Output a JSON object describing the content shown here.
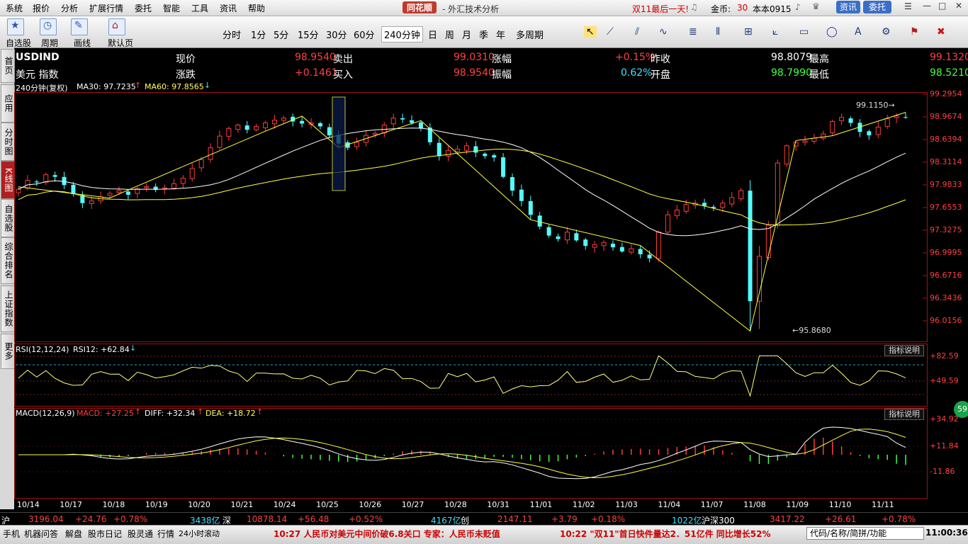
{
  "menu": [
    "系统",
    "报价",
    "分析",
    "扩展行情",
    "委托",
    "智能",
    "工具",
    "资讯",
    "帮助"
  ],
  "brand": {
    "name": "同花顺",
    "subtitle": "- 外汇技术分析"
  },
  "promo": "双11最后一天!",
  "account": {
    "gold_label": "金币:",
    "gold_value": "30",
    "user": "本本0915"
  },
  "top_buttons": {
    "info": "资讯",
    "trade": "委托"
  },
  "toolbar": {
    "left_buttons": [
      "自选股",
      "周期",
      "画线",
      "默认页"
    ],
    "periods": [
      "分时",
      "1分",
      "5分",
      "15分",
      "30分",
      "60分",
      "240分钟",
      "日",
      "周",
      "月",
      "季",
      "年",
      "多周期"
    ],
    "selected_period": "240分钟"
  },
  "left_tabs": [
    "首页",
    "应用",
    "分时图",
    "K线图",
    "自选股",
    "综合排名",
    "上证指数",
    "更多"
  ],
  "quote": {
    "symbol": "USDIND",
    "name": "美元 指数",
    "labels": {
      "price": "现价",
      "change": "涨跌",
      "sell": "卖出",
      "buy": "买入",
      "pct": "涨幅",
      "amp": "振幅",
      "prev": "昨收",
      "open": "开盘",
      "high": "最高",
      "low": "最低"
    },
    "price": "98.9540",
    "change": "+0.1461",
    "sell": "99.0310",
    "buy": "98.9540",
    "pct": "+0.15%",
    "amp": "0.62%",
    "prev": "98.8079",
    "open": "98.7990",
    "high": "99.1320",
    "low": "98.5210"
  },
  "indicators": {
    "main": {
      "title": "240分钟(复权)",
      "ma30_label": "MA30: 97.7235",
      "ma60_label": "MA60: 97.8565"
    },
    "rsi": {
      "title": "RSI(12,12,24)",
      "value_label": "RSI12: +62.84"
    },
    "macd": {
      "title": "MACD(12,26,9)",
      "macd_label": "MACD: +27.25",
      "diff_label": "DIFF: +32.34",
      "dea_label": "DEA: +18.72"
    },
    "explain": "指标说明"
  },
  "chart_data": {
    "type": "candlestick",
    "price_axis": [
      "99.2954",
      "98.9674",
      "98.6394",
      "98.3114",
      "97.9833",
      "97.6553",
      "97.3275",
      "96.9995",
      "96.6716",
      "96.3436",
      "96.0156"
    ],
    "rsi_axis": [
      "+82.59",
      "+49.59"
    ],
    "macd_axis": [
      "+34.92",
      "+11.84",
      "-11.86"
    ],
    "annotations": {
      "high": "99.1150",
      "low": "95.8680"
    },
    "dates": [
      "10/14",
      "10/17",
      "10/18",
      "10/19",
      "10/20",
      "10/21",
      "10/24",
      "10/25",
      "10/26",
      "10/27",
      "10/28",
      "10/31",
      "11/01",
      "11/02",
      "11/03",
      "11/04",
      "11/07",
      "11/08",
      "11/09",
      "11/10",
      "11/11"
    ],
    "close_series": [
      97.92,
      98.05,
      98.02,
      98.13,
      98.1,
      97.98,
      97.85,
      97.72,
      97.75,
      97.81,
      97.86,
      97.9,
      97.84,
      97.93,
      97.96,
      97.91,
      97.94,
      98.0,
      98.08,
      98.22,
      98.35,
      98.52,
      98.69,
      98.8,
      98.85,
      98.78,
      98.83,
      98.88,
      98.92,
      98.95,
      98.9,
      98.87,
      98.88,
      98.83,
      98.7,
      98.58,
      98.52,
      98.6,
      98.7,
      98.73,
      98.85,
      98.95,
      98.93,
      98.88,
      98.8,
      98.6,
      98.4,
      98.48,
      98.5,
      98.55,
      98.45,
      98.4,
      98.38,
      98.1,
      97.9,
      97.75,
      97.55,
      97.38,
      97.25,
      97.2,
      97.3,
      97.18,
      97.1,
      97.12,
      97.15,
      97.08,
      97.02,
      97.06,
      96.98,
      96.92,
      97.3,
      97.55,
      97.62,
      97.7,
      97.72,
      97.68,
      97.65,
      97.72,
      97.8,
      97.9,
      96.28,
      96.95,
      97.4,
      98.3,
      98.55,
      98.6,
      98.62,
      98.66,
      98.72,
      98.9,
      98.96,
      98.88,
      98.75,
      98.7,
      98.82,
      98.94,
      98.98,
      98.96
    ]
  },
  "ticker": [
    {
      "label": "沪",
      "color": "#ffffff"
    },
    {
      "label": "3196.04",
      "color": "#ff4040"
    },
    {
      "label": "+24.76",
      "color": "#ff4040"
    },
    {
      "label": "+0.78%",
      "color": "#ff4040"
    },
    {
      "label": "3438亿",
      "color": "#40e0ff"
    },
    {
      "label": "深",
      "color": "#ffffff"
    },
    {
      "label": "10878.14",
      "color": "#ff4040"
    },
    {
      "label": "+56.48",
      "color": "#ff4040"
    },
    {
      "label": "+0.52%",
      "color": "#ff4040"
    },
    {
      "label": "4167亿",
      "color": "#40e0ff"
    },
    {
      "label": "创",
      "color": "#ffffff"
    },
    {
      "label": "2147.11",
      "color": "#ff4040"
    },
    {
      "label": "+3.79",
      "color": "#ff4040"
    },
    {
      "label": "+0.18%",
      "color": "#ff4040"
    },
    {
      "label": "1022亿",
      "color": "#40e0ff"
    },
    {
      "label": "沪深300",
      "color": "#ffffff"
    },
    {
      "label": "3417.22",
      "color": "#ff4040"
    },
    {
      "label": "+26.61",
      "color": "#ff4040"
    },
    {
      "label": "+0.78%",
      "color": "#ff4040"
    }
  ],
  "status": {
    "items": [
      "手机",
      "机器问答",
      "解盘",
      "股市日记",
      "股灵通",
      "行情",
      "24小时滚动"
    ],
    "news1": "10:27 人民币对美元中间价破6.8关口 专家：人民币未贬值",
    "news2": "10:22 \"双11\"首日快件量达2．51亿件 同比增长52%",
    "search": "代码/名称/简拼/功能",
    "time": "11:00:36"
  },
  "bubble": "59"
}
